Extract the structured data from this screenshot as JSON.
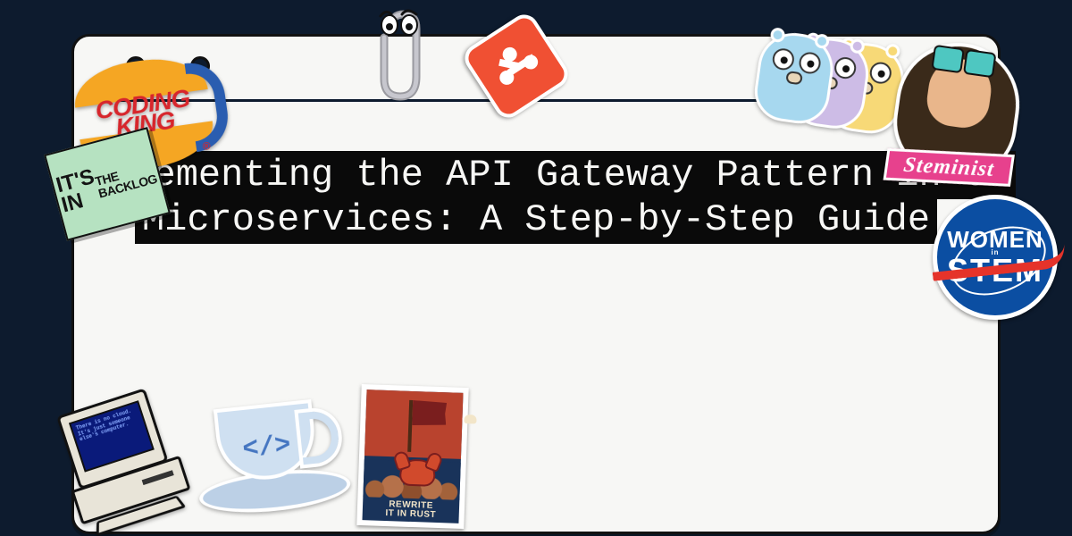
{
  "title": "Implementing the API Gateway Pattern in Go Microservices: A Step-by-Step Guide",
  "stickers": {
    "coding_king": {
      "line1": "CODING",
      "line2": "KING",
      "reg": "®"
    },
    "backlog": {
      "line1": "IT'S IN",
      "line2": "THE BACKLOG"
    },
    "steminist": {
      "banner": "Steminist"
    },
    "women_in_stem": {
      "line1": "WOMEN",
      "line2": "in",
      "line3": "STEM"
    },
    "rust": {
      "line1": "REWRITE",
      "line2": "IT IN RUST"
    },
    "retro_pc_screen": "There is no cloud. It's just someone else's computer.",
    "teacup_logo": "</>"
  }
}
